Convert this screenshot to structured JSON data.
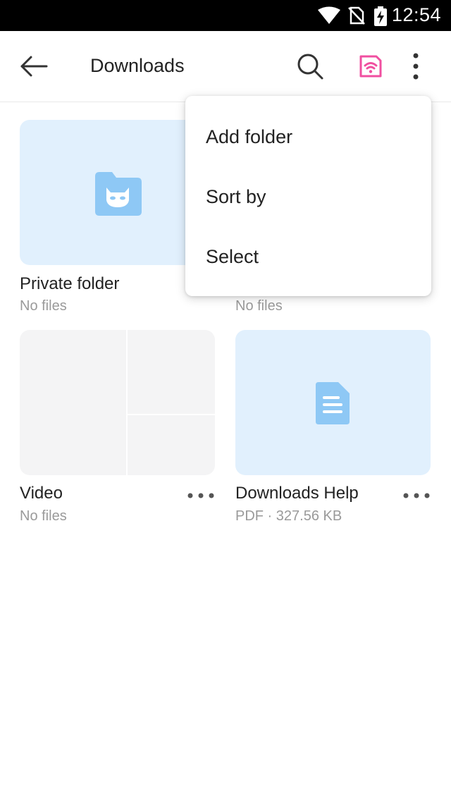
{
  "status_bar": {
    "time": "12:54"
  },
  "app_bar": {
    "title": "Downloads"
  },
  "tiles": [
    {
      "name": "Private folder",
      "sub": "No files",
      "icon": "private-folder-icon"
    },
    {
      "name": "",
      "sub": "No files"
    },
    {
      "name": "Video",
      "sub": "No files"
    },
    {
      "name": "Downloads Help",
      "sub": "PDF · 327.56 KB",
      "icon": "document-icon"
    }
  ],
  "menu": {
    "items": [
      "Add folder",
      "Sort by",
      "Select"
    ]
  },
  "colors": {
    "accent_pink": "#f04fa0",
    "tile_blue": "#e1f0fd",
    "icon_blue": "#8ec8f5",
    "muted_text": "#9a9a9a"
  }
}
